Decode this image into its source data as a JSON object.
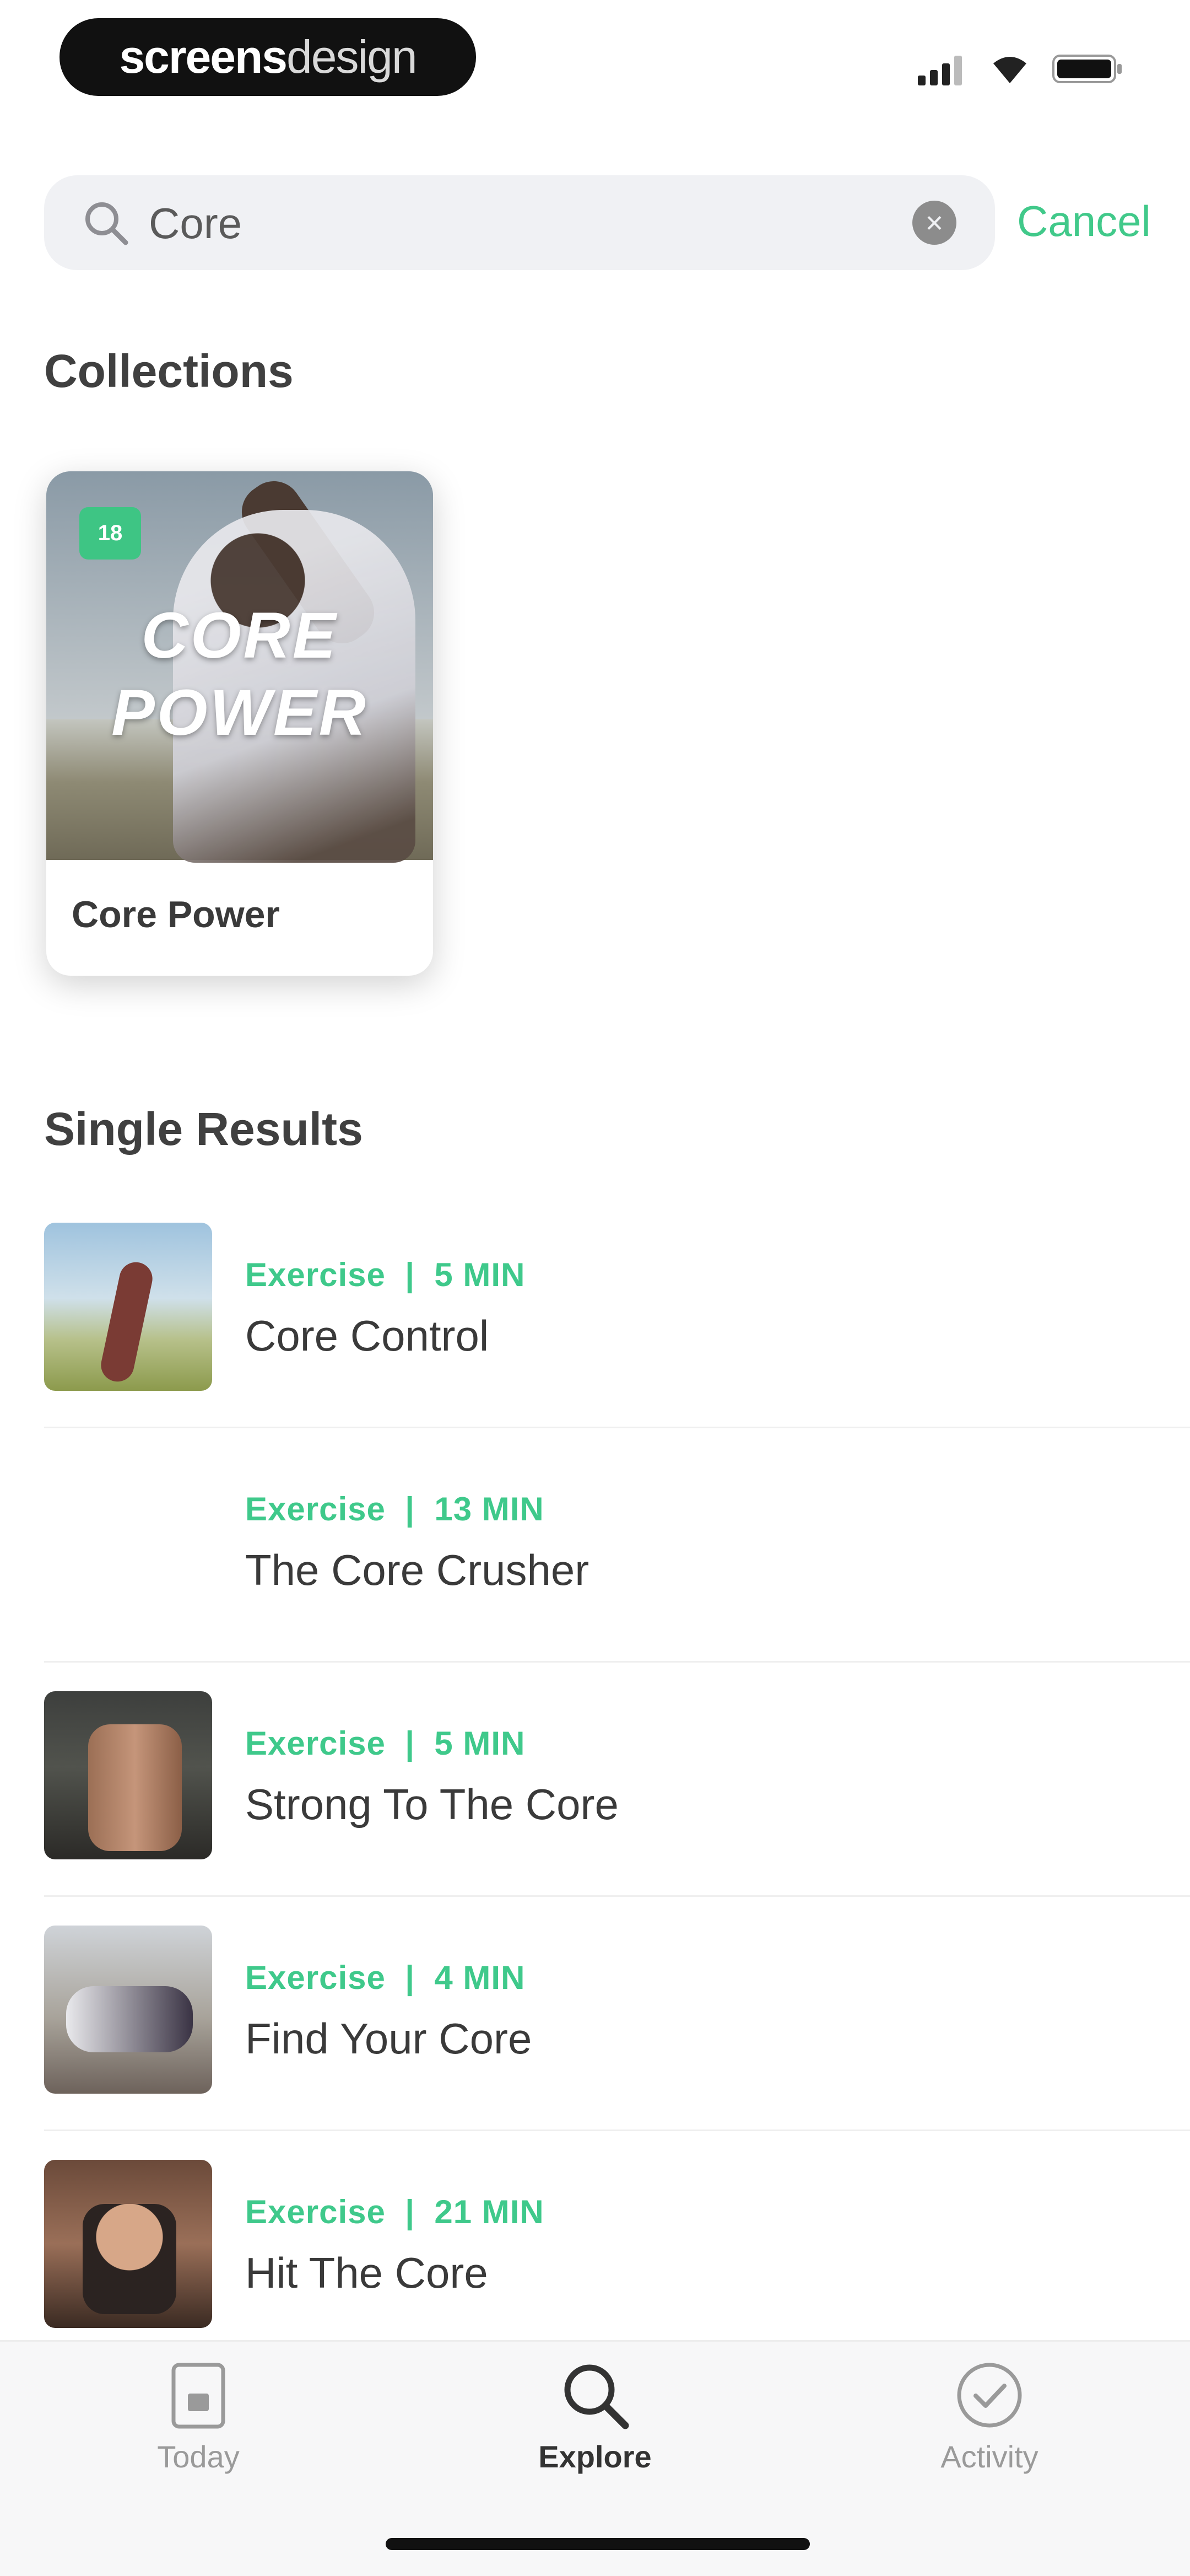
{
  "status_bar": {
    "brand_bold": "screens",
    "brand_thin": "design"
  },
  "search": {
    "value": "Core",
    "placeholder": "Search",
    "cancel_label": "Cancel"
  },
  "collections": {
    "section_title": "Collections",
    "items": [
      {
        "badge": "18",
        "cover_line1": "CORE",
        "cover_line2": "POWER",
        "label": "Core Power"
      }
    ]
  },
  "results": {
    "section_title": "Single Results",
    "separator": "|",
    "items": [
      {
        "type": "Exercise",
        "duration": "5 MIN",
        "title": "Core Control"
      },
      {
        "type": "Exercise",
        "duration": "13 MIN",
        "title": "The Core Crusher"
      },
      {
        "type": "Exercise",
        "duration": "5 MIN",
        "title": "Strong To The Core"
      },
      {
        "type": "Exercise",
        "duration": "4 MIN",
        "title": "Find Your Core"
      },
      {
        "type": "Exercise",
        "duration": "21 MIN",
        "title": "Hit The Core"
      }
    ]
  },
  "tab_bar": {
    "tabs": [
      {
        "label": "Today",
        "icon": "calendar-icon",
        "active": false
      },
      {
        "label": "Explore",
        "icon": "search-icon",
        "active": true
      },
      {
        "label": "Activity",
        "icon": "check-circle-icon",
        "active": false
      }
    ]
  },
  "colors": {
    "accent": "#41c98a",
    "badge": "#3ec584",
    "text": "#3a3a3a",
    "search_bg": "#f0f1f4"
  }
}
